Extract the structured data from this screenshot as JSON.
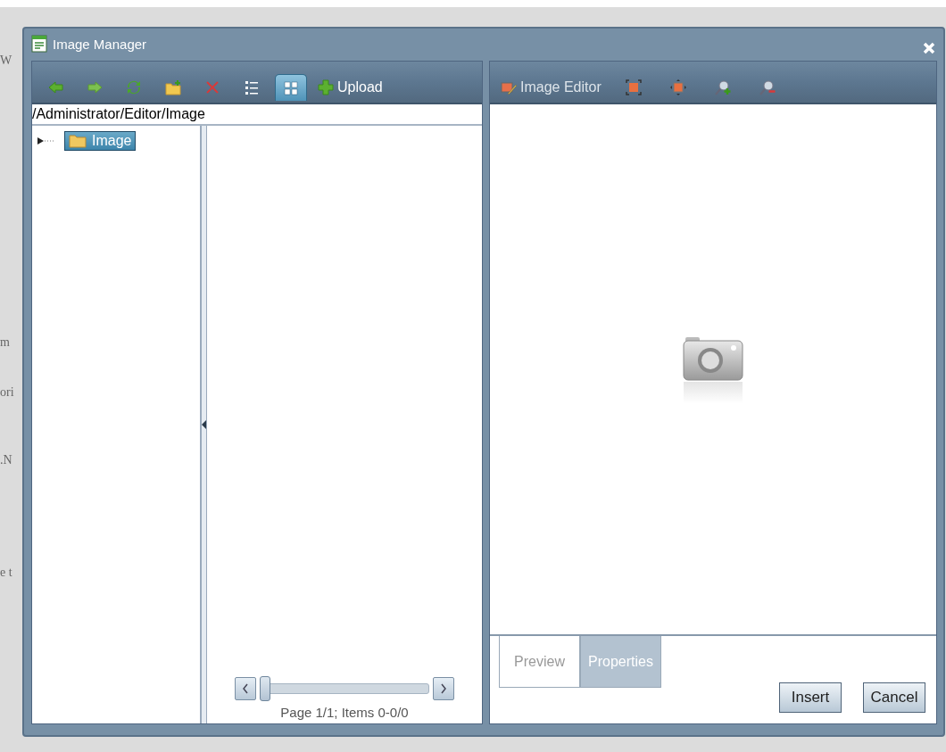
{
  "background_text": [
    "W",
    "m",
    "ori",
    ".N",
    "e t"
  ],
  "window": {
    "title": "Image Manager"
  },
  "toolbar": [
    {
      "kind": "back",
      "selected": false
    },
    {
      "kind": "forward",
      "selected": false
    },
    {
      "kind": "refresh",
      "selected": false
    },
    {
      "kind": "new-folder",
      "selected": false
    },
    {
      "kind": "delete",
      "selected": false
    },
    {
      "kind": "list-view",
      "selected": false
    },
    {
      "kind": "thumbnail-view",
      "selected": true
    },
    {
      "kind": "upload",
      "label": "Upload",
      "selected": false
    }
  ],
  "path": "/Administrator/Editor/Image",
  "tree": [
    {
      "label": "Image",
      "selected": true,
      "expanded": false
    }
  ],
  "pager": {
    "level": 0,
    "text": "Page 1/1; Items 0-0/0"
  },
  "editor_toolbar": [
    {
      "kind": "image-editor",
      "label": "Image Editor"
    },
    {
      "kind": "fit"
    },
    {
      "kind": "actual-size"
    },
    {
      "kind": "zoom-in"
    },
    {
      "kind": "zoom-out"
    }
  ],
  "preview_tabs": [
    {
      "label": "Preview",
      "selected": false
    },
    {
      "label": "Properties",
      "selected": true
    }
  ],
  "buttons": [
    "Insert",
    "Cancel"
  ]
}
